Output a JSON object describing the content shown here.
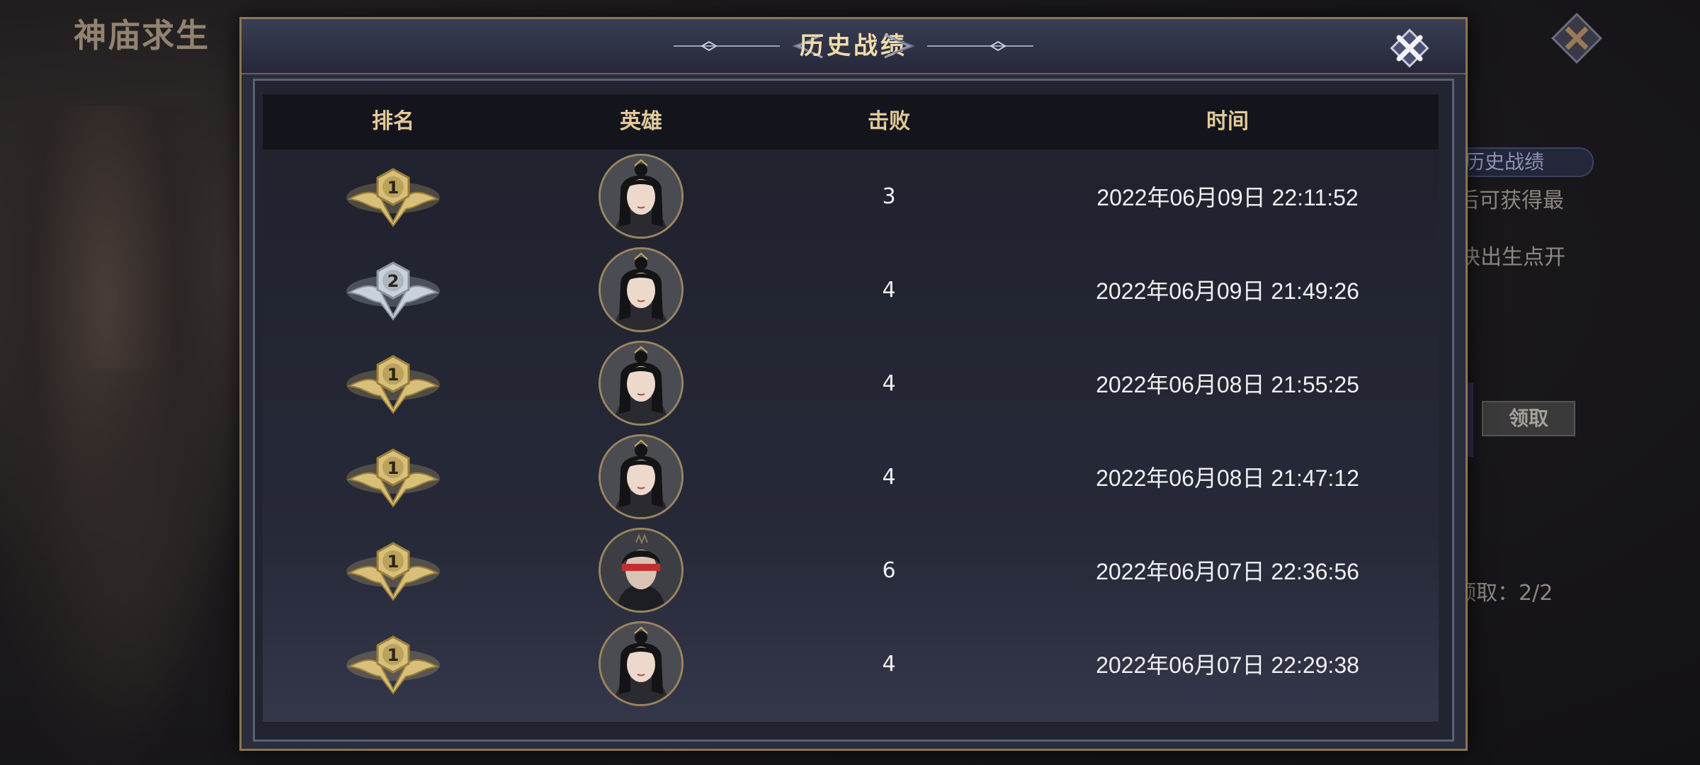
{
  "background": {
    "mode_title": "神庙求生",
    "tag": "历史战绩",
    "lines": [
      "后可获得最",
      "块出生点开",
      "领取：2/2"
    ],
    "claim_button": "领取"
  },
  "dialog": {
    "title": "历史战绩",
    "columns": [
      "排名",
      "英雄",
      "击败",
      "时间"
    ],
    "rows": [
      {
        "rank": "1",
        "medal": "gold",
        "hero": "female-hero",
        "kills": "3",
        "time": "2022年06月09日  22:11:52"
      },
      {
        "rank": "2",
        "medal": "silver",
        "hero": "female-hero",
        "kills": "4",
        "time": "2022年06月09日  21:49:26"
      },
      {
        "rank": "1",
        "medal": "gold",
        "hero": "female-hero",
        "kills": "4",
        "time": "2022年06月08日  21:55:25"
      },
      {
        "rank": "1",
        "medal": "gold",
        "hero": "female-hero",
        "kills": "4",
        "time": "2022年06月08日  21:47:12"
      },
      {
        "rank": "1",
        "medal": "gold",
        "hero": "blindfolded-male-hero",
        "kills": "6",
        "time": "2022年06月07日  22:36:56"
      },
      {
        "rank": "1",
        "medal": "gold",
        "hero": "female-hero",
        "kills": "4",
        "time": "2022年06月07日  22:29:38"
      }
    ]
  },
  "colors": {
    "gold": "#d8bf7a",
    "silver": "#c9d2dc",
    "accent": "#f1dcaa"
  }
}
